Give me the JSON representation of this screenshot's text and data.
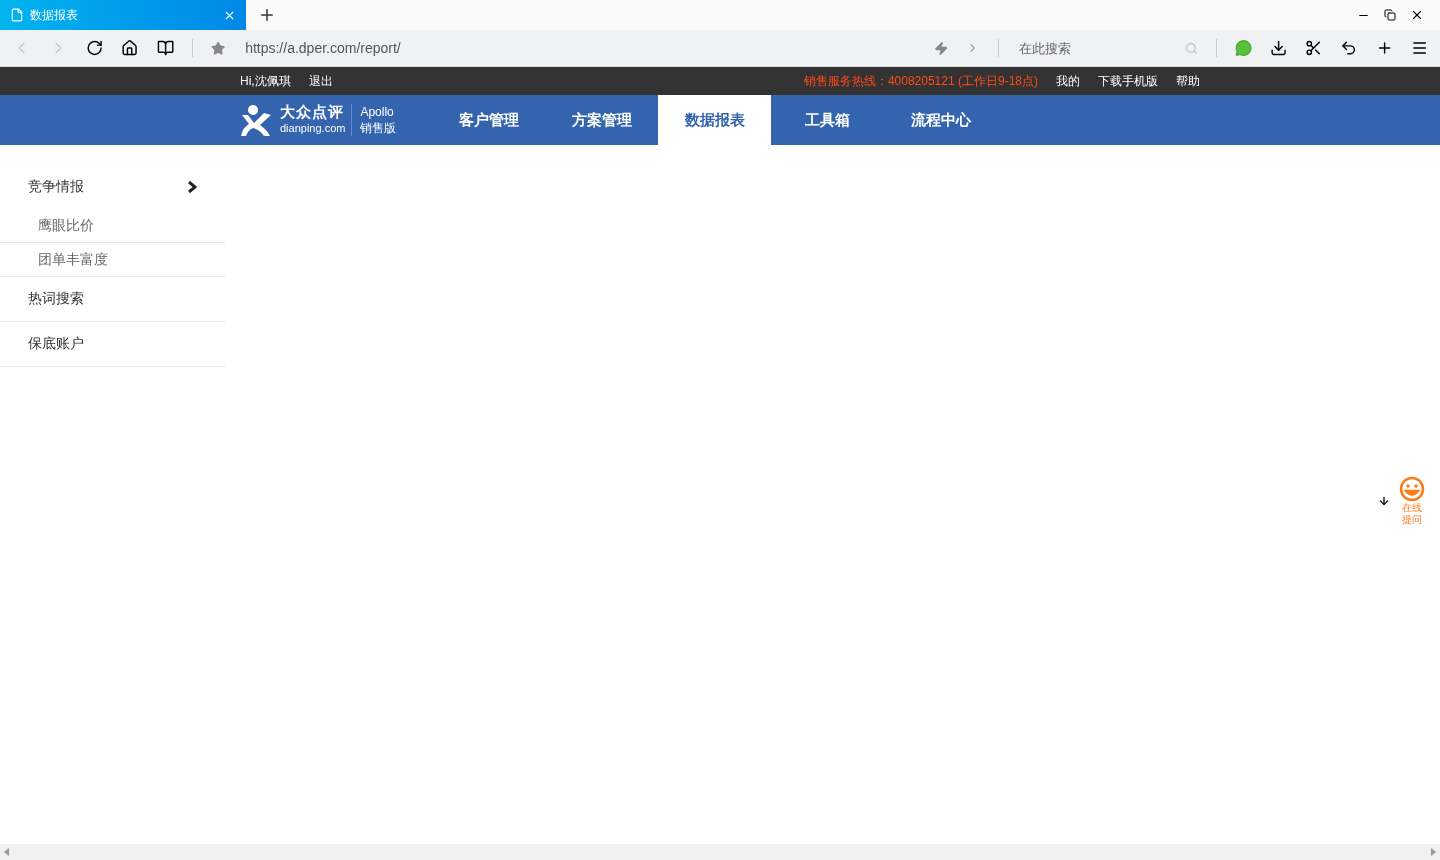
{
  "browser": {
    "tab": {
      "title": "数据报表",
      "selected": true
    },
    "address": "https://a.dper.com/report/",
    "search": {
      "placeholder": "在此搜索"
    }
  },
  "topbar": {
    "greeting": "Hi,沈佩琪",
    "logout": "退出",
    "hotline": "销售服务热线：4008205121 (工作日9-18点)",
    "links": [
      "我的",
      "下载手机版",
      "帮助"
    ]
  },
  "logo": {
    "brand": "大众点评",
    "domain": "dianping.com",
    "product": "Apollo",
    "edition": "销售版"
  },
  "nav": [
    {
      "label": "客户管理",
      "selected": false
    },
    {
      "label": "方案管理",
      "selected": false
    },
    {
      "label": "数据报表",
      "selected": true
    },
    {
      "label": "工具箱",
      "selected": false
    },
    {
      "label": "流程中心",
      "selected": false
    }
  ],
  "sidebar": {
    "items": [
      {
        "label": "竞争情报",
        "expanded": true,
        "children": [
          {
            "label": "鹰眼比价"
          },
          {
            "label": "团单丰富度"
          }
        ]
      },
      {
        "label": "热词搜索",
        "expanded": false
      },
      {
        "label": "保底账户",
        "expanded": false
      }
    ]
  },
  "help": {
    "lines": [
      "在线",
      "提问"
    ]
  }
}
